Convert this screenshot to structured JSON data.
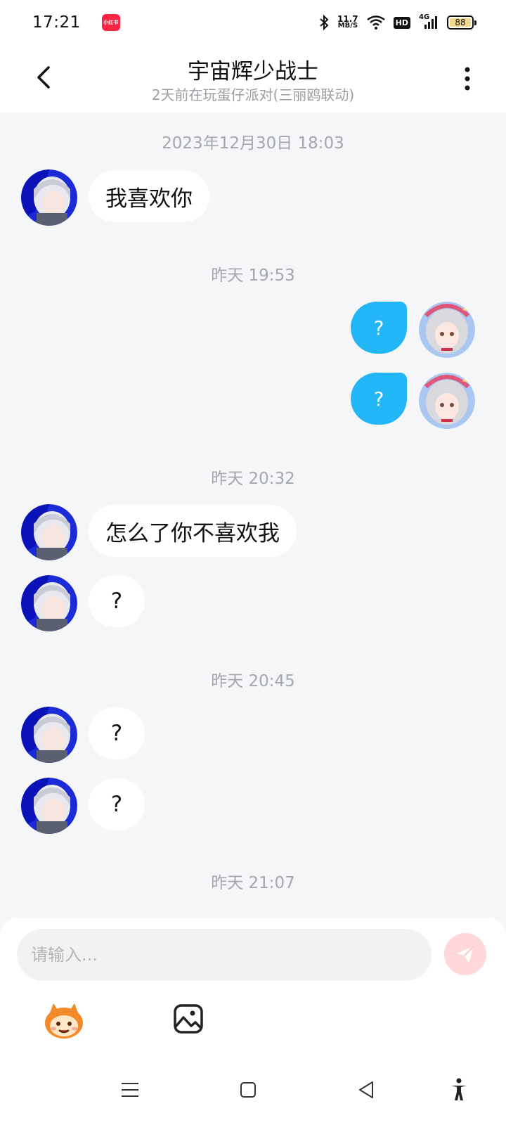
{
  "status_bar": {
    "time": "17:21",
    "app_badge": "小红书",
    "net_speed_value": "11.7",
    "net_speed_unit": "MB/S",
    "hd": "HD",
    "network": "4G",
    "battery": "88",
    "battery_level": 0.88
  },
  "header": {
    "title": "宇宙辉少战士",
    "subtitle": "2天前在玩蛋仔派对(三丽鸥联动)"
  },
  "messages": [
    {
      "type": "timestamp",
      "text": "2023年12月30日 18:03"
    },
    {
      "type": "in",
      "text": "我喜欢你"
    },
    {
      "type": "timestamp",
      "text": "昨天 19:53"
    },
    {
      "type": "out",
      "text": "?"
    },
    {
      "type": "out",
      "text": "?"
    },
    {
      "type": "timestamp",
      "text": "昨天 20:32"
    },
    {
      "type": "in",
      "text": "怎么了你不喜欢我"
    },
    {
      "type": "in",
      "text": "?"
    },
    {
      "type": "timestamp",
      "text": "昨天 20:45"
    },
    {
      "type": "in",
      "text": "?"
    },
    {
      "type": "in",
      "text": "?"
    },
    {
      "type": "timestamp",
      "text": "昨天 21:07"
    }
  ],
  "composer": {
    "placeholder": "请输入...",
    "value": ""
  },
  "colors": {
    "outgoing_bubble": "#22b6f7",
    "incoming_bubble": "#ffffff",
    "send_button": "#ffd9d9",
    "background": "#f5f6f8"
  },
  "icons": {
    "back": "chevron-left-icon",
    "more": "more-vertical-icon",
    "send": "paper-plane-icon",
    "emoji": "eggy-face-icon",
    "image": "image-icon",
    "nav": [
      "menu-icon",
      "home-square-icon",
      "back-triangle-icon",
      "accessibility-icon"
    ]
  }
}
